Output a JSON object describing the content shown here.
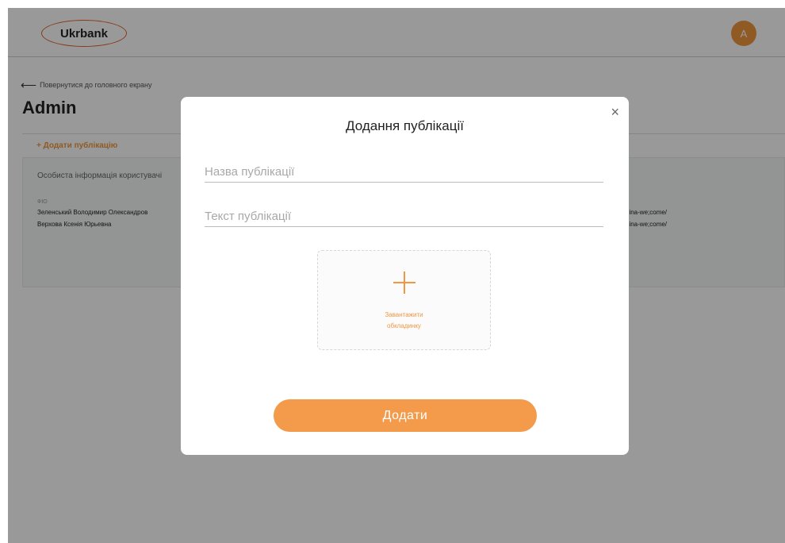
{
  "header": {
    "logo_text": "Ukrbank",
    "avatar_initial": "A"
  },
  "page": {
    "back_link": "Повернутися до головного екрану",
    "title": "Admin",
    "add_publication": "+ Додати публікацію"
  },
  "info_card": {
    "title": "Особиста інформація користувачі",
    "column_label": "ФІО",
    "rows": [
      {
        "name": "Зеленський Володимир Олександров",
        "link": "hina-we;come/"
      },
      {
        "name": "Верхова Ксенія Юрьевна",
        "link": "hina-we;come/"
      }
    ]
  },
  "modal": {
    "title": "Додання публікації",
    "close_glyph": "×",
    "title_placeholder": "Назва публікації",
    "text_placeholder": "Текст публікації",
    "upload_label_line1": "Завантажити",
    "upload_label_line2": "обкладинку",
    "submit_label": "Додати"
  },
  "colors": {
    "accent": "#f0973f",
    "button": "#f39b4a",
    "logo_outline": "#e0632a",
    "overlay": "rgba(0,0,0,0.4)"
  },
  "icons": [
    "back-arrow-icon",
    "close-icon",
    "plus-icon"
  ]
}
